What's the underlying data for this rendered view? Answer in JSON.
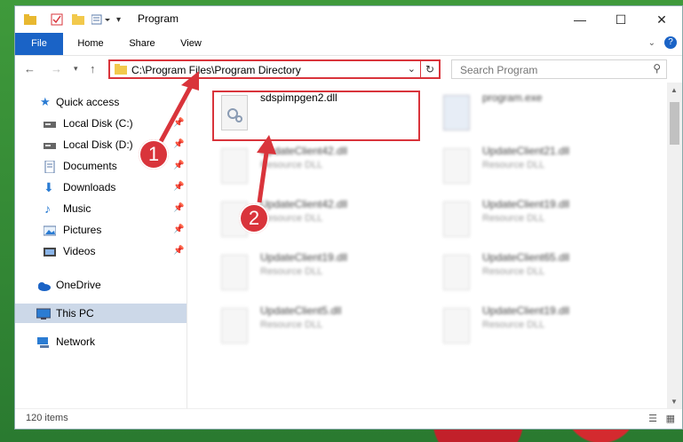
{
  "window": {
    "title": "Program"
  },
  "ribbon_tabs": [
    "File",
    "Home",
    "Share",
    "View"
  ],
  "address": {
    "path": "C:\\Program Files\\Program Directory"
  },
  "search": {
    "placeholder": "Search Program"
  },
  "sidebar": {
    "items": [
      {
        "label": "Quick access",
        "icon": "star-icon"
      },
      {
        "label": "Local Disk (C:)",
        "icon": "disk-icon"
      },
      {
        "label": "Local Disk (D:)",
        "icon": "disk-icon"
      },
      {
        "label": "Documents",
        "icon": "documents-icon"
      },
      {
        "label": "Downloads",
        "icon": "download-icon"
      },
      {
        "label": "Music",
        "icon": "music-icon"
      },
      {
        "label": "Pictures",
        "icon": "pictures-icon"
      },
      {
        "label": "Videos",
        "icon": "videos-icon"
      },
      {
        "label": "OneDrive",
        "icon": "cloud-icon"
      },
      {
        "label": "This PC",
        "icon": "pc-icon"
      },
      {
        "label": "Network",
        "icon": "network-icon"
      }
    ]
  },
  "files": [
    {
      "name": "sdspimpgen2.dll",
      "type": ""
    },
    {
      "name": "program.exe",
      "type": ""
    },
    {
      "name": "UpdateClient42.dll",
      "type": "Resource DLL"
    },
    {
      "name": "UpdateClient21.dll",
      "type": "Resource DLL"
    },
    {
      "name": "UpdateClient42.dll",
      "type": "Resource DLL"
    },
    {
      "name": "UpdateClient19.dll",
      "type": "Resource DLL"
    },
    {
      "name": "UpdateClient19.dll",
      "type": "Resource DLL"
    },
    {
      "name": "UpdateClient65.dll",
      "type": "Resource DLL"
    },
    {
      "name": "UpdateClient5.dll",
      "type": "Resource DLL"
    },
    {
      "name": "UpdateClient19.dll",
      "type": "Resource DLL"
    }
  ],
  "status": {
    "items": "120 items"
  },
  "callouts": [
    "1",
    "2"
  ],
  "colors": {
    "accent": "#1a63c6",
    "highlight": "#d9343b"
  }
}
